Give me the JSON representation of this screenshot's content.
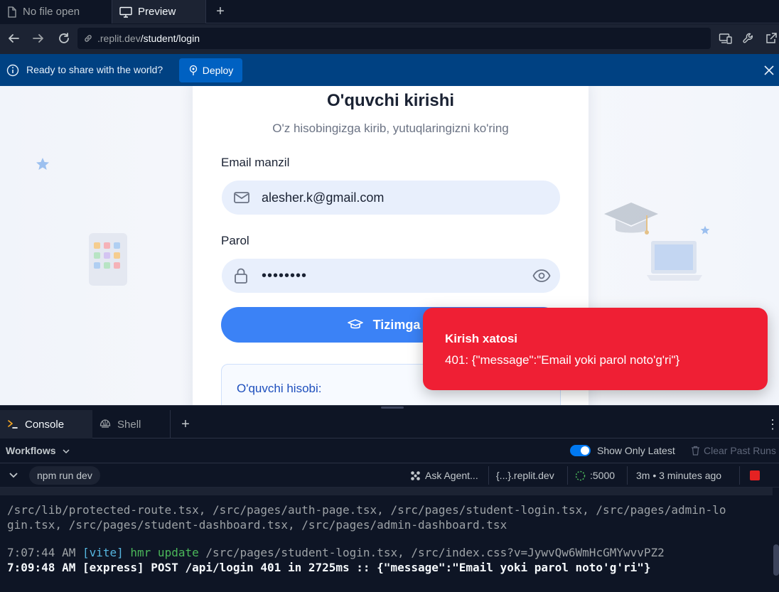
{
  "tabs": {
    "no_file": "No file open",
    "preview": "Preview",
    "add": "+"
  },
  "nav": {
    "url_host": ".replit.dev",
    "url_path": "/student/login"
  },
  "deploy_bar": {
    "message": "Ready to share with the world?",
    "button": "Deploy"
  },
  "login": {
    "title": "O'quvchi kirishi",
    "subtitle": "O'z hisobingizga kirib, yutuqlaringizni ko'ring",
    "email_label": "Email manzil",
    "email_value": "alesher.k@gmail.com",
    "password_label": "Parol",
    "password_value": "••••••••",
    "submit": "Tizimga ki",
    "info_title": "O'quvchi hisobi:"
  },
  "toast": {
    "title": "Kirish xatosi",
    "message": "401: {\"message\":\"Email yoki parol noto'g'ri\"}"
  },
  "bottom_tabs": {
    "console": "Console",
    "shell": "Shell",
    "add": "+",
    "menu": "⋮"
  },
  "workflows": {
    "label": "Workflows",
    "show_only_latest": "Show Only Latest",
    "clear_past_runs": "Clear Past Runs"
  },
  "run": {
    "command": "npm run dev",
    "ask_agent": "Ask Agent...",
    "domain": "{...}.replit.dev",
    "port": ":5000",
    "time": "3m • 3 minutes ago"
  },
  "console": {
    "line1": "/src/lib/protected-route.tsx, /src/pages/auth-page.tsx, /src/pages/student-login.tsx, /src/pages/admin-lo",
    "line2": "gin.tsx, /src/pages/student-dashboard.tsx, /src/pages/admin-dashboard.tsx",
    "line3_time": "7:07:44 AM ",
    "line3_tag": "[vite]",
    "line3_hmr": " hmr update",
    "line3_rest": " /src/pages/student-login.tsx, /src/index.css?v=JywvQw6WmHcGMYwvvPZ2",
    "line4": "7:09:48 AM [express] POST /api/login 401 in 2725ms :: {\"message\":\"Email yoki parol noto'g'ri\"}"
  }
}
